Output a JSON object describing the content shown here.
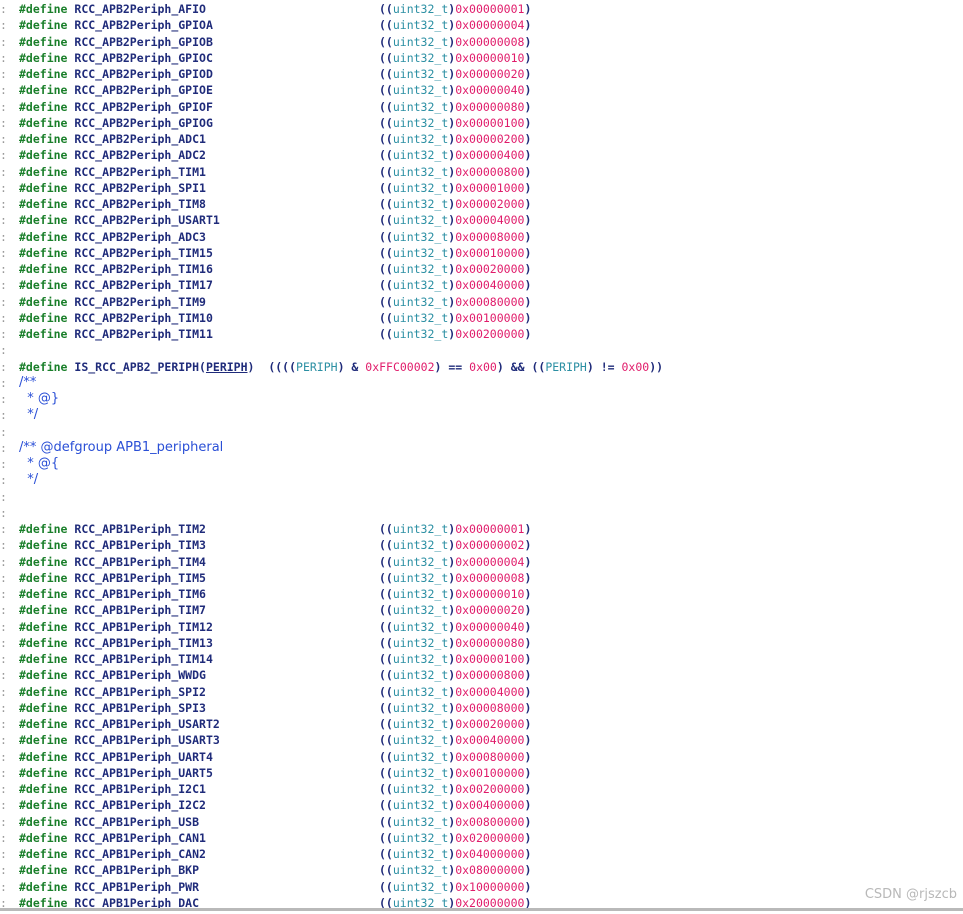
{
  "gutter_mark": ":",
  "define_kw": "#define",
  "cast_prefix": "((",
  "cast_type": "uint32_t",
  "cast_mid": ")",
  "cast_suffix": ")",
  "apb2_defines": [
    {
      "name": "RCC_APB2Periph_AFIO",
      "value": "0x00000001"
    },
    {
      "name": "RCC_APB2Periph_GPIOA",
      "value": "0x00000004"
    },
    {
      "name": "RCC_APB2Periph_GPIOB",
      "value": "0x00000008"
    },
    {
      "name": "RCC_APB2Periph_GPIOC",
      "value": "0x00000010"
    },
    {
      "name": "RCC_APB2Periph_GPIOD",
      "value": "0x00000020"
    },
    {
      "name": "RCC_APB2Periph_GPIOE",
      "value": "0x00000040"
    },
    {
      "name": "RCC_APB2Periph_GPIOF",
      "value": "0x00000080"
    },
    {
      "name": "RCC_APB2Periph_GPIOG",
      "value": "0x00000100"
    },
    {
      "name": "RCC_APB2Periph_ADC1",
      "value": "0x00000200"
    },
    {
      "name": "RCC_APB2Periph_ADC2",
      "value": "0x00000400"
    },
    {
      "name": "RCC_APB2Periph_TIM1",
      "value": "0x00000800"
    },
    {
      "name": "RCC_APB2Periph_SPI1",
      "value": "0x00001000"
    },
    {
      "name": "RCC_APB2Periph_TIM8",
      "value": "0x00002000"
    },
    {
      "name": "RCC_APB2Periph_USART1",
      "value": "0x00004000"
    },
    {
      "name": "RCC_APB2Periph_ADC3",
      "value": "0x00008000"
    },
    {
      "name": "RCC_APB2Periph_TIM15",
      "value": "0x00010000"
    },
    {
      "name": "RCC_APB2Periph_TIM16",
      "value": "0x00020000"
    },
    {
      "name": "RCC_APB2Periph_TIM17",
      "value": "0x00040000"
    },
    {
      "name": "RCC_APB2Periph_TIM9",
      "value": "0x00080000"
    },
    {
      "name": "RCC_APB2Periph_TIM10",
      "value": "0x00100000"
    },
    {
      "name": "RCC_APB2Periph_TIM11",
      "value": "0x00200000"
    }
  ],
  "is_macro": {
    "define": "#define",
    "name": "IS_RCC_APB2_PERIPH",
    "open": "(",
    "param": "PERIPH",
    "close": ")",
    "body_open": "((((",
    "periph1": "PERIPH",
    "op_and": ") & ",
    "mask": "0xFFC00002",
    "cmp_eq": ") == ",
    "zero1": "0x00",
    "logic_and": ") && ((",
    "periph2": "PERIPH",
    "cmp_ne": ") != ",
    "zero2": "0x00",
    "body_close": "))"
  },
  "comment_block_1": [
    "/**",
    "  * @}",
    "  */"
  ],
  "comment_block_2": [
    "/** @defgroup APB1_peripheral",
    "  * @{",
    "  */"
  ],
  "apb1_defines": [
    {
      "name": "RCC_APB1Periph_TIM2",
      "value": "0x00000001"
    },
    {
      "name": "RCC_APB1Periph_TIM3",
      "value": "0x00000002"
    },
    {
      "name": "RCC_APB1Periph_TIM4",
      "value": "0x00000004"
    },
    {
      "name": "RCC_APB1Periph_TIM5",
      "value": "0x00000008"
    },
    {
      "name": "RCC_APB1Periph_TIM6",
      "value": "0x00000010"
    },
    {
      "name": "RCC_APB1Periph_TIM7",
      "value": "0x00000020"
    },
    {
      "name": "RCC_APB1Periph_TIM12",
      "value": "0x00000040"
    },
    {
      "name": "RCC_APB1Periph_TIM13",
      "value": "0x00000080"
    },
    {
      "name": "RCC_APB1Periph_TIM14",
      "value": "0x00000100"
    },
    {
      "name": "RCC_APB1Periph_WWDG",
      "value": "0x00000800"
    },
    {
      "name": "RCC_APB1Periph_SPI2",
      "value": "0x00004000"
    },
    {
      "name": "RCC_APB1Periph_SPI3",
      "value": "0x00008000"
    },
    {
      "name": "RCC_APB1Periph_USART2",
      "value": "0x00020000"
    },
    {
      "name": "RCC_APB1Periph_USART3",
      "value": "0x00040000"
    },
    {
      "name": "RCC_APB1Periph_UART4",
      "value": "0x00080000"
    },
    {
      "name": "RCC_APB1Periph_UART5",
      "value": "0x00100000"
    },
    {
      "name": "RCC_APB1Periph_I2C1",
      "value": "0x00200000"
    },
    {
      "name": "RCC_APB1Periph_I2C2",
      "value": "0x00400000"
    },
    {
      "name": "RCC_APB1Periph_USB",
      "value": "0x00800000"
    },
    {
      "name": "RCC_APB1Periph_CAN1",
      "value": "0x02000000"
    },
    {
      "name": "RCC_APB1Periph_CAN2",
      "value": "0x04000000"
    },
    {
      "name": "RCC_APB1Periph_BKP",
      "value": "0x08000000"
    },
    {
      "name": "RCC_APB1Periph_PWR",
      "value": "0x10000000"
    },
    {
      "name": "RCC_APB1Periph_DAC",
      "value": "0x20000000"
    }
  ],
  "watermark": "CSDN @rjszcb"
}
